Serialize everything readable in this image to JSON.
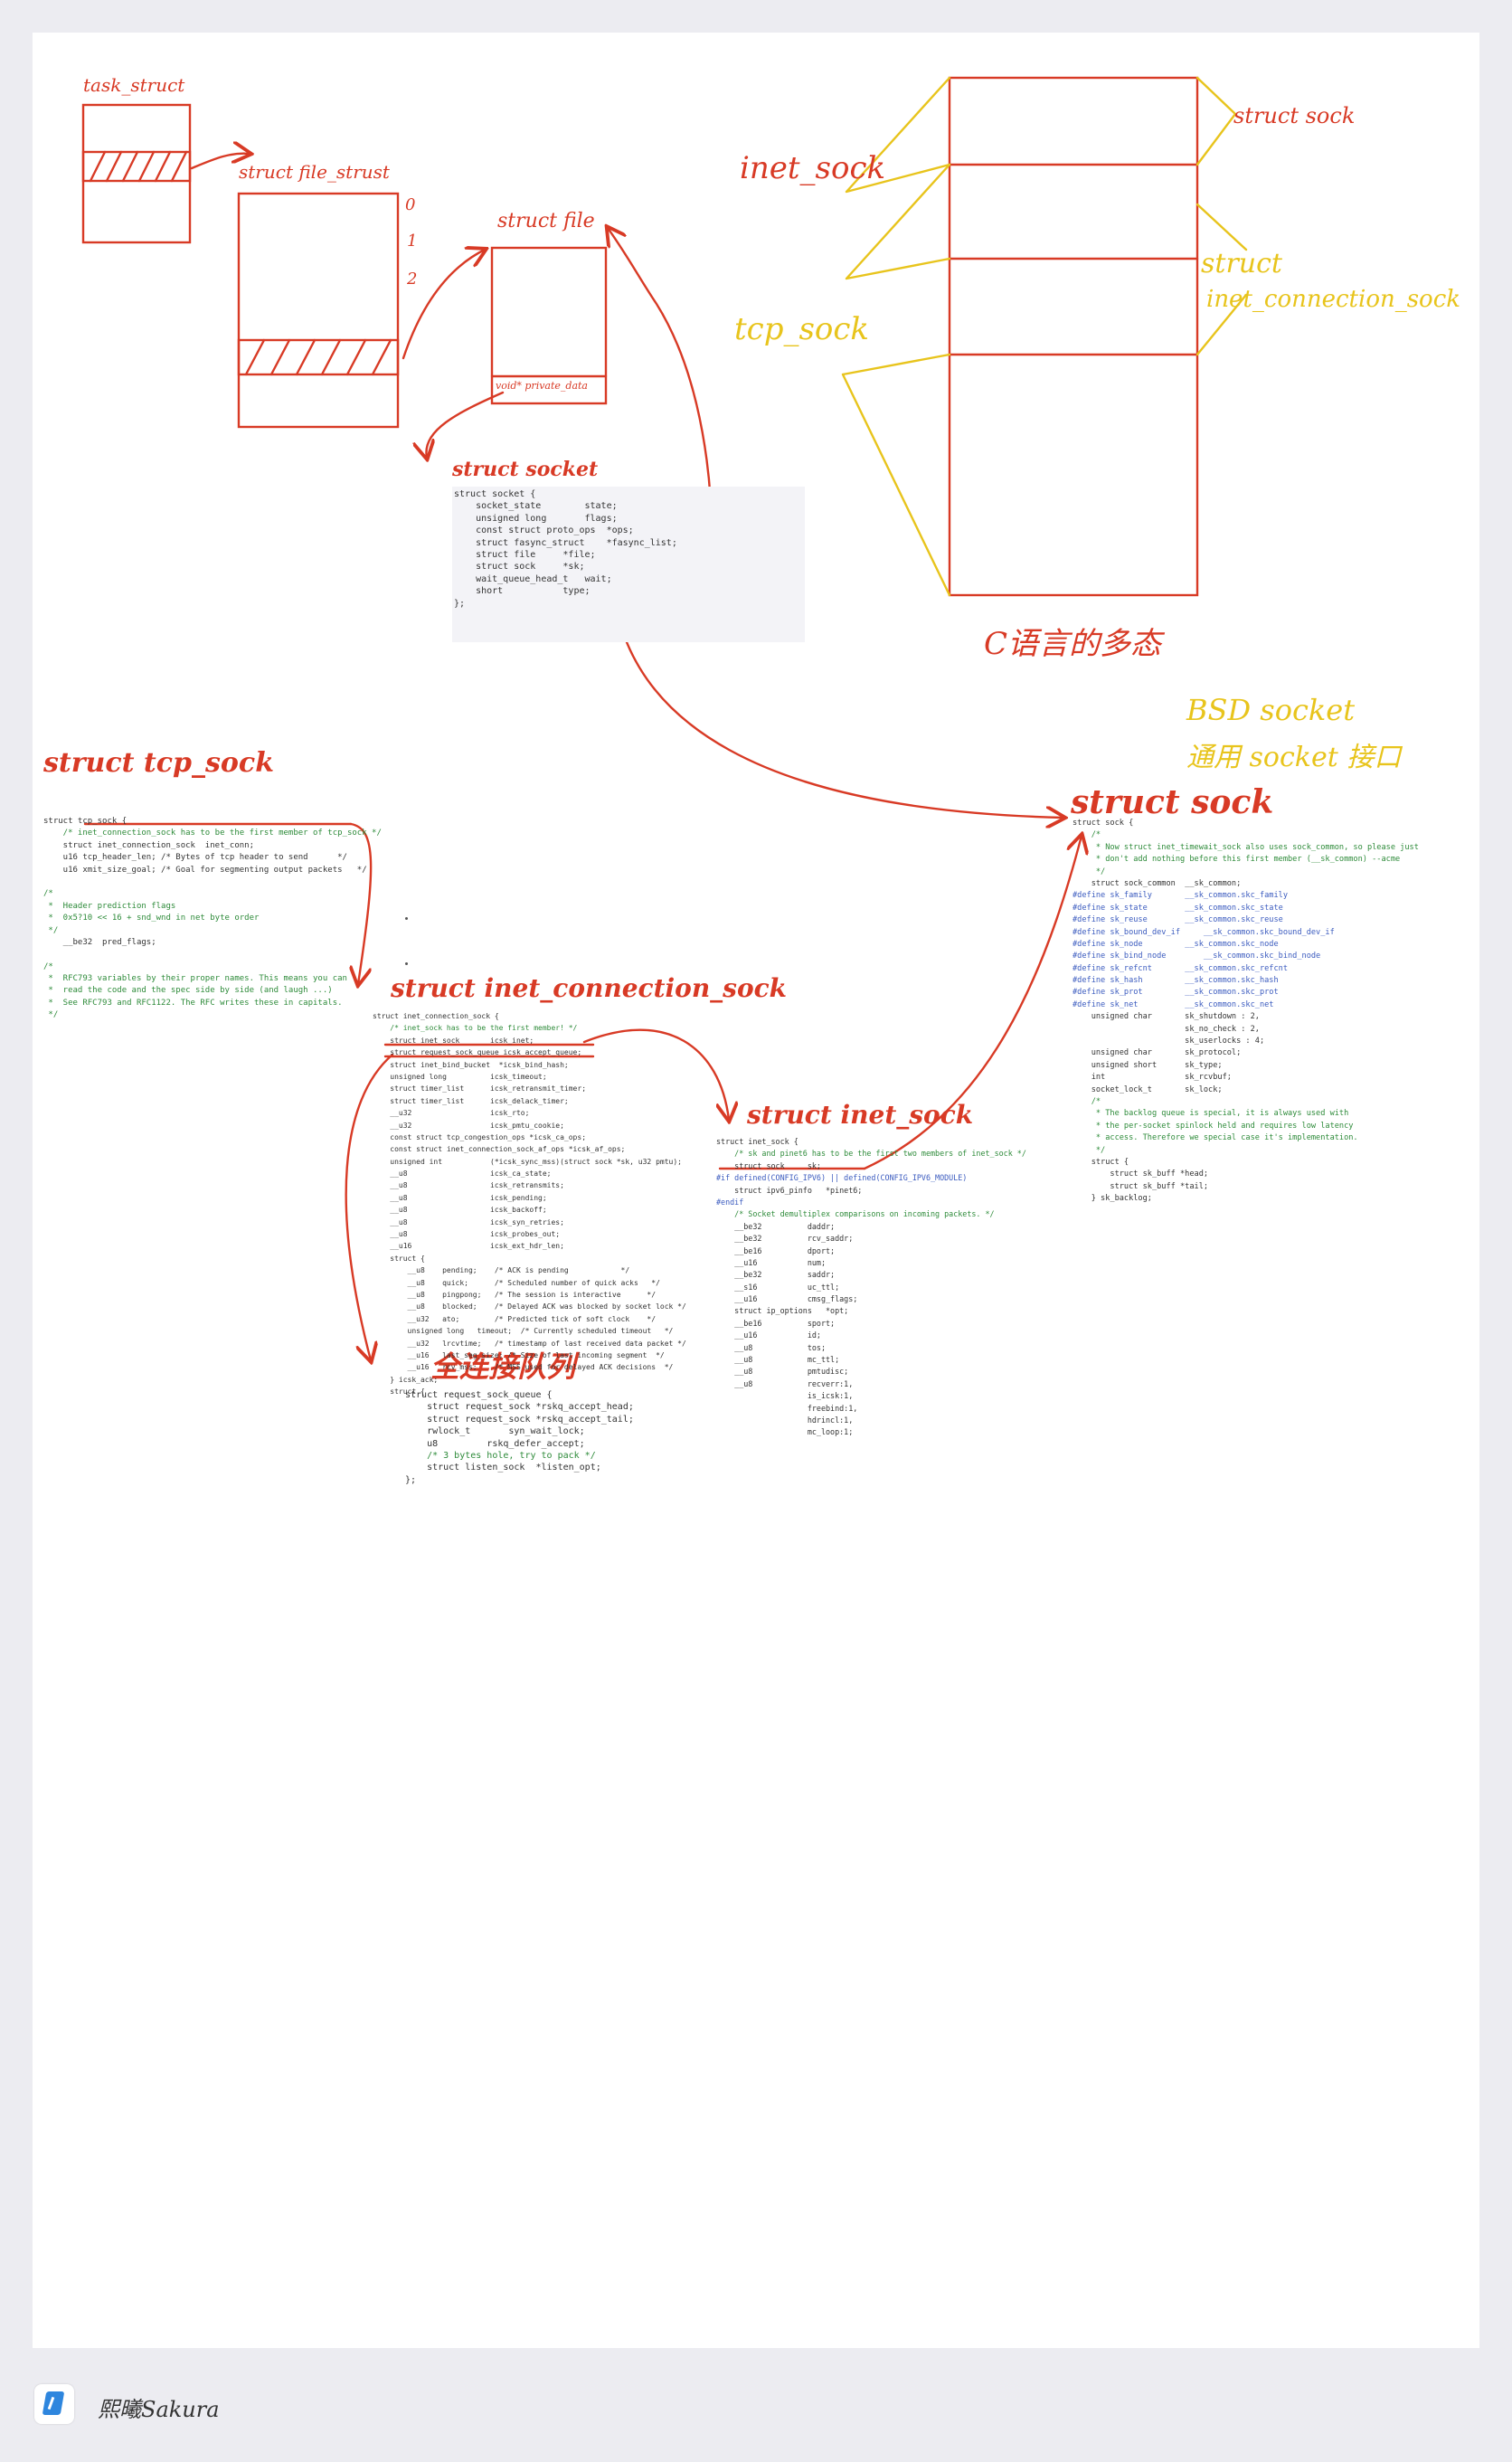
{
  "colors": {
    "ink_red": "#d83a25",
    "ink_yellow": "#e8c41c",
    "canvas": "#ffffff",
    "background": "#ececf1"
  },
  "labels": {
    "task_struct": "task_struct",
    "file_struct": "struct file_strust",
    "struct_file": "struct file",
    "private_data": "void* private_data",
    "idx0": "0",
    "idx1": "1",
    "idx2": "2",
    "struct_socket": "struct socket",
    "inet_sock": "inet_sock",
    "tcp_sock_y": "tcp_sock",
    "struct_sock_top": "struct sock",
    "struct_word": "struct",
    "icsk_y": "inet_connection_sock",
    "c_lang": "C语言的多态",
    "bsd1": "BSD socket",
    "bsd2": "通用 socket 接口",
    "struct_sock_big": "struct sock",
    "struct_tcp_sock": "struct tcp_sock",
    "struct_icsk": "struct inet_connection_sock",
    "struct_inet_sock": "struct inet_sock",
    "accept_queue": "全连接队列"
  },
  "code": {
    "socket": [
      "struct socket {",
      "    socket_state        state;",
      "    unsigned long       flags;",
      "    const struct proto_ops  *ops;",
      "    struct fasync_struct    *fasync_list;",
      "    struct file     *file;",
      "    struct sock     *sk;",
      "    wait_queue_head_t   wait;",
      "    short           type;",
      "};"
    ],
    "tcp_sock": [
      "struct tcp_sock {",
      "    /* inet_connection_sock has to be the first member of tcp_sock */",
      "    struct inet_connection_sock  inet_conn;",
      "    u16 tcp_header_len; /* Bytes of tcp header to send      */",
      "    u16 xmit_size_goal; /* Goal for segmenting output packets   */",
      "",
      "/*",
      " *  Header prediction flags",
      " *  0x5?10 << 16 + snd_wnd in net byte order",
      " */",
      "    __be32  pred_flags;",
      "",
      "/*",
      " *  RFC793 variables by their proper names. This means you can",
      " *  read the code and the spec side by side (and laugh ...)",
      " *  See RFC793 and RFC1122. The RFC writes these in capitals.",
      " */"
    ],
    "icsk": [
      "struct inet_connection_sock {",
      "    /* inet_sock has to be the first member! */",
      "    struct inet_sock       icsk_inet;",
      "    struct request_sock_queue icsk_accept_queue;",
      "    struct inet_bind_bucket  *icsk_bind_hash;",
      "    unsigned long          icsk_timeout;",
      "    struct timer_list      icsk_retransmit_timer;",
      "    struct timer_list      icsk_delack_timer;",
      "    __u32                  icsk_rto;",
      "    __u32                  icsk_pmtu_cookie;",
      "    const struct tcp_congestion_ops *icsk_ca_ops;",
      "    const struct inet_connection_sock_af_ops *icsk_af_ops;",
      "    unsigned int           (*icsk_sync_mss)(struct sock *sk, u32 pmtu);",
      "    __u8                   icsk_ca_state;",
      "    __u8                   icsk_retransmits;",
      "    __u8                   icsk_pending;",
      "    __u8                   icsk_backoff;",
      "    __u8                   icsk_syn_retries;",
      "    __u8                   icsk_probes_out;",
      "    __u16                  icsk_ext_hdr_len;",
      "    struct {",
      "        __u8    pending;    /* ACK is pending            */",
      "        __u8    quick;      /* Scheduled number of quick acks   */",
      "        __u8    pingpong;   /* The session is interactive      */",
      "        __u8    blocked;    /* Delayed ACK was blocked by socket lock */",
      "        __u32   ato;        /* Predicted tick of soft clock    */",
      "        unsigned long   timeout;  /* Currently scheduled timeout   */",
      "        __u32   lrcvtime;   /* timestamp of last received data packet */",
      "        __u16   last_seg_size; /* Size of last incoming segment  */",
      "        __u16   rcv_mss;    /* MSS used for delayed ACK decisions  */",
      "    } icsk_ack;",
      "    struct {"
    ],
    "rsq": [
      "struct request_sock_queue {",
      "    struct request_sock *rskq_accept_head;",
      "    struct request_sock *rskq_accept_tail;",
      "    rwlock_t       syn_wait_lock;",
      "    u8         rskq_defer_accept;",
      "    /* 3 bytes hole, try to pack */",
      "    struct listen_sock  *listen_opt;",
      "};"
    ],
    "inet_sock": [
      "struct inet_sock {",
      "    /* sk and pinet6 has to be the first two members of inet_sock */",
      "    struct sock     sk;",
      "#if defined(CONFIG_IPV6) || defined(CONFIG_IPV6_MODULE)",
      "    struct ipv6_pinfo   *pinet6;",
      "#endif",
      "    /* Socket demultiplex comparisons on incoming packets. */",
      "    __be32          daddr;",
      "    __be32          rcv_saddr;",
      "    __be16          dport;",
      "    __u16           num;",
      "    __be32          saddr;",
      "    __s16           uc_ttl;",
      "    __u16           cmsg_flags;",
      "    struct ip_options   *opt;",
      "    __be16          sport;",
      "    __u16           id;",
      "    __u8            tos;",
      "    __u8            mc_ttl;",
      "    __u8            pmtudisc;",
      "    __u8            recverr:1,",
      "                    is_icsk:1,",
      "                    freebind:1,",
      "                    hdrincl:1,",
      "                    mc_loop:1;"
    ],
    "sock": [
      "struct sock {",
      "    /*",
      "     * Now struct inet_timewait_sock also uses sock_common, so please just",
      "     * don't add nothing before this first member (__sk_common) --acme",
      "     */",
      "    struct sock_common  __sk_common;",
      "#define sk_family       __sk_common.skc_family",
      "#define sk_state        __sk_common.skc_state",
      "#define sk_reuse        __sk_common.skc_reuse",
      "#define sk_bound_dev_if     __sk_common.skc_bound_dev_if",
      "#define sk_node         __sk_common.skc_node",
      "#define sk_bind_node        __sk_common.skc_bind_node",
      "#define sk_refcnt       __sk_common.skc_refcnt",
      "#define sk_hash         __sk_common.skc_hash",
      "#define sk_prot         __sk_common.skc_prot",
      "#define sk_net          __sk_common.skc_net",
      "    unsigned char       sk_shutdown : 2,",
      "                        sk_no_check : 2,",
      "                        sk_userlocks : 4;",
      "    unsigned char       sk_protocol;",
      "    unsigned short      sk_type;",
      "    int                 sk_rcvbuf;",
      "    socket_lock_t       sk_lock;",
      "    /*",
      "     * The backlog queue is special, it is always used with",
      "     * the per-socket spinlock held and requires low latency",
      "     * access. Therefore we special case it's implementation.",
      "     */",
      "    struct {",
      "        struct sk_buff *head;",
      "        struct sk_buff *tail;",
      "    } sk_backlog;"
    ]
  },
  "footer": {
    "name": "熙曦Sakura"
  }
}
